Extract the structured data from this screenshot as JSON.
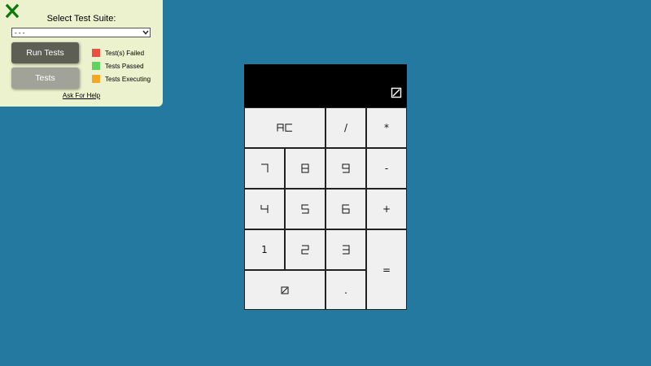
{
  "test_panel": {
    "title": "Select Test Suite:",
    "close_icon": "close-x-icon",
    "suite_select": {
      "selected": "- - -",
      "options": [
        "- - -"
      ]
    },
    "run_button_label": "Run Tests",
    "tests_button_label": "Tests",
    "legend": [
      {
        "label": "Test(s) Failed",
        "color": "#e9503f"
      },
      {
        "label": "Tests Passed",
        "color": "#5fd25f"
      },
      {
        "label": "Tests Executing",
        "color": "#f5a623"
      }
    ],
    "help_link": "Ask For Help"
  },
  "calculator": {
    "display_value": "0",
    "keys": {
      "clear": "AC",
      "divide": "/",
      "multiply": "*",
      "seven": "7",
      "eight": "8",
      "nine": "9",
      "subtract": "-",
      "four": "4",
      "five": "5",
      "six": "6",
      "add": "+",
      "one": "1",
      "two": "2",
      "three": "3",
      "equals": "=",
      "zero": "0",
      "decimal": "."
    }
  },
  "colors": {
    "background": "#23799f",
    "panel": "#ebf2cd",
    "display": "#000000",
    "key": "#f0f0f0",
    "close_icon": "#0a7a0a"
  }
}
